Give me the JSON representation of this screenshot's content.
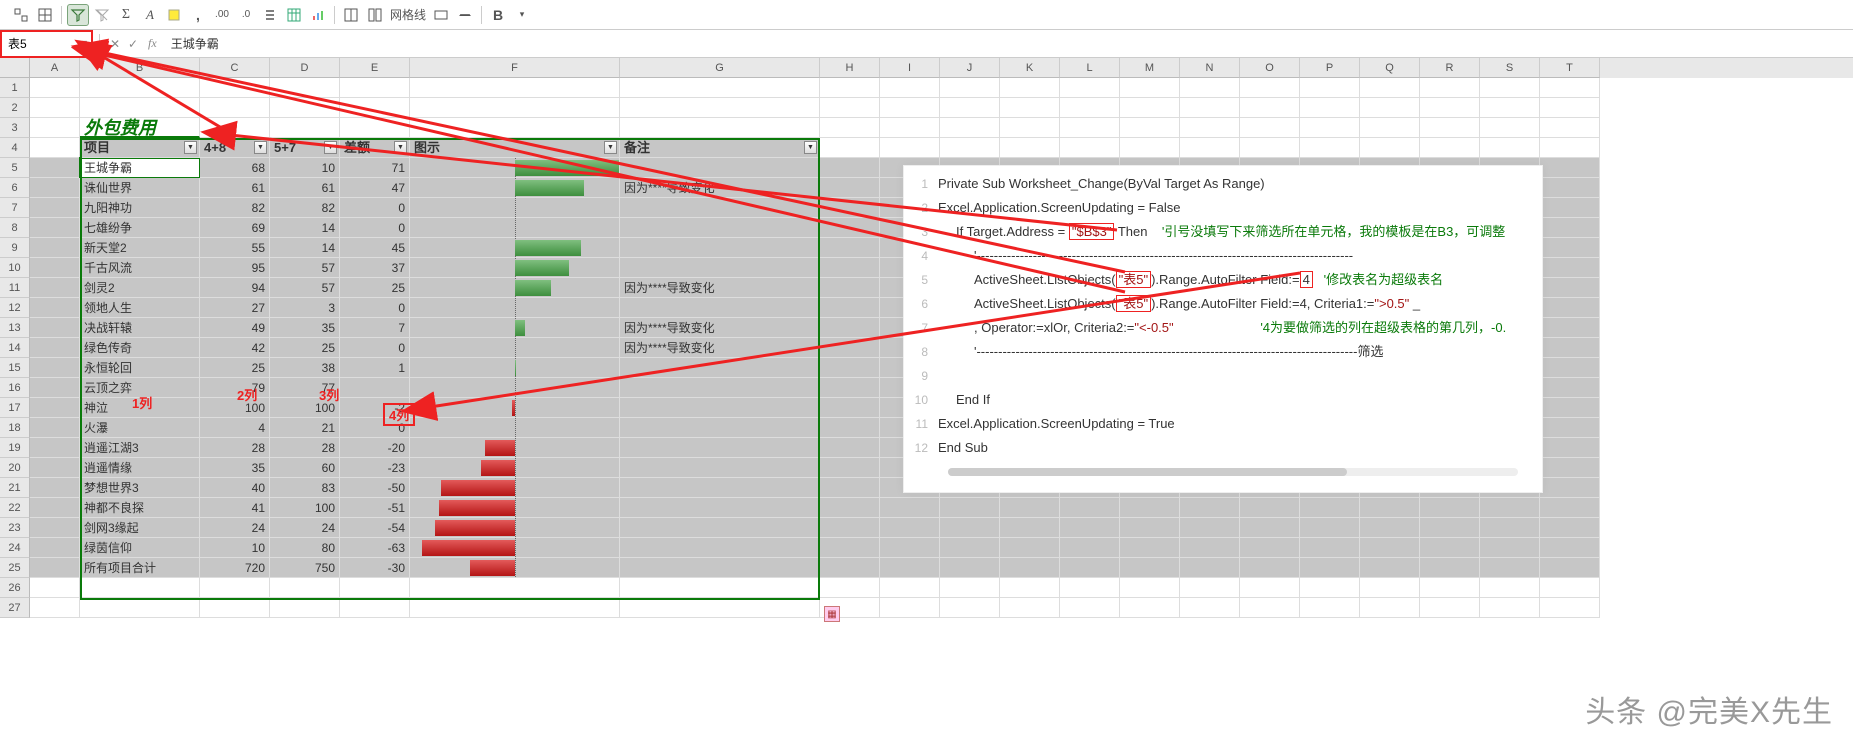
{
  "toolbar": {
    "gridline_label": "网格线",
    "bold_label": "B"
  },
  "name_box": "表5",
  "formula_bar": "王城争霸",
  "columns": [
    "A",
    "B",
    "C",
    "D",
    "E",
    "F",
    "G",
    "H",
    "I",
    "J",
    "K",
    "L",
    "M",
    "N",
    "O",
    "P",
    "Q",
    "R",
    "S",
    "T"
  ],
  "row_count": 27,
  "title": "外包费用",
  "headers": {
    "h1": "项目",
    "h2": "4+8",
    "h3": "5+7",
    "h4": "差额",
    "h5": "图示",
    "h6": "备注"
  },
  "rows": [
    {
      "name": "王城争霸",
      "c": 68,
      "d": 10,
      "e": 71,
      "bar": 71,
      "note": "",
      "active": true
    },
    {
      "name": "诛仙世界",
      "c": 61,
      "d": 61,
      "e": 47,
      "bar": 47,
      "note": "因为****导致变化"
    },
    {
      "name": "九阳神功",
      "c": 82,
      "d": 82,
      "e": 0,
      "bar": 0,
      "note": ""
    },
    {
      "name": "七雄纷争",
      "c": 69,
      "d": 14,
      "e": 0,
      "bar": 0,
      "note": ""
    },
    {
      "name": "新天堂2",
      "c": 55,
      "d": 14,
      "e": 45,
      "bar": 45,
      "note": ""
    },
    {
      "name": "千古风流",
      "c": 95,
      "d": 57,
      "e": 37,
      "bar": 37,
      "note": ""
    },
    {
      "name": "剑灵2",
      "c": 94,
      "d": 57,
      "e": 25,
      "bar": 25,
      "note": "因为****导致变化"
    },
    {
      "name": "领地人生",
      "c": 27,
      "d": 3,
      "e": 0,
      "bar": 0,
      "note": ""
    },
    {
      "name": "决战轩辕",
      "c": 49,
      "d": 35,
      "e": 7,
      "bar": 7,
      "note": "因为****导致变化"
    },
    {
      "name": "绿色传奇",
      "c": 42,
      "d": 25,
      "e": 0,
      "bar": 0,
      "note": "因为****导致变化"
    },
    {
      "name": "永恒轮回",
      "c": 25,
      "d": 38,
      "e": 1,
      "bar": 1,
      "note": ""
    },
    {
      "name": "云顶之弈",
      "c": 79,
      "d": 77,
      "e": "",
      "bar": 0,
      "note": ""
    },
    {
      "name": "神泣",
      "c": 100,
      "d": 100,
      "e": -2,
      "bar": -2,
      "note": ""
    },
    {
      "name": "火瀑",
      "c": 4,
      "d": 21,
      "e": 0,
      "bar": 0,
      "note": ""
    },
    {
      "name": "逍遥江湖3",
      "c": 28,
      "d": 28,
      "e": -20,
      "bar": -20,
      "note": ""
    },
    {
      "name": "逍遥情缘",
      "c": 35,
      "d": 60,
      "e": -23,
      "bar": -23,
      "note": ""
    },
    {
      "name": "梦想世界3",
      "c": 40,
      "d": 83,
      "e": -50,
      "bar": -50,
      "note": ""
    },
    {
      "name": "神都不良探",
      "c": 41,
      "d": 100,
      "e": -51,
      "bar": -51,
      "note": ""
    },
    {
      "name": "剑网3缘起",
      "c": 24,
      "d": 24,
      "e": -54,
      "bar": -54,
      "note": ""
    },
    {
      "name": "绿茵信仰",
      "c": 10,
      "d": 80,
      "e": -63,
      "bar": -63,
      "note": ""
    },
    {
      "name": "所有项目合计",
      "c": 720,
      "d": 750,
      "e": -30,
      "bar": -30,
      "note": ""
    }
  ],
  "bar_max": 71,
  "anno": {
    "col1": "1列",
    "col2": "2列",
    "col3": "3列",
    "col4": "4列"
  },
  "col4_boxed_value": "4列",
  "code": {
    "l1": "Private Sub Worksheet_Change(ByVal Target As Range)",
    "l2": "Excel.Application.ScreenUpdating = False",
    "l3_a": "If Target.Address = ",
    "l3_hl": "\"$B$3\"",
    "l3_b": " Then",
    "l3_cmt": "'引号没填写下来筛选所在单元格，我的模板是在B3，可调整",
    "l4_cmt": "'---------------------------------------------------------------------------------------",
    "l5_a": "ActiveSheet.ListObjects(",
    "l5_hl": "\"表5\"",
    "l5_b": ").Range.AutoFilter Field:=",
    "l5_hl2": "4",
    "l5_cmt": "'修改表名为超级表名",
    "l6_a": "ActiveSheet.ListObjects(",
    "l6_hl": "\"表5\"",
    "l6_b": ").Range.AutoFilter Field:=4, Criteria1:=",
    "l6_str": "\">0.5\"",
    "l6_c": " _",
    "l7_a": ", Operator:=xlOr, Criteria2:=",
    "l7_str": "\"<-0.5\"",
    "l7_cmt": "'4为要做筛选的列在超级表格的第几列，-0.",
    "l8_cmt": "'----------------------------------------------------------------------------------------筛选",
    "l10": "End If",
    "l11": "Excel.Application.ScreenUpdating = True",
    "l12": "End Sub"
  },
  "watermark": "头条 @完美X先生"
}
